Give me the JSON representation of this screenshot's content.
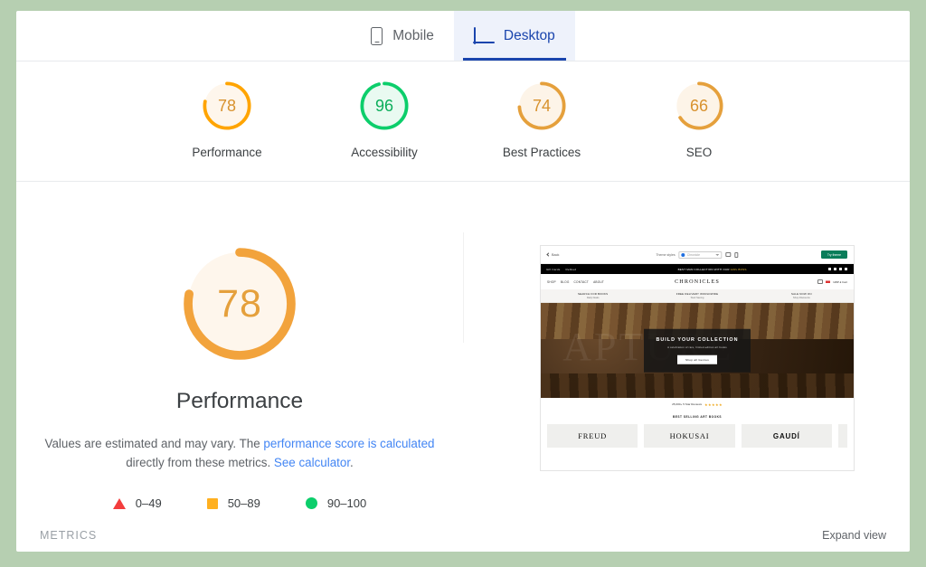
{
  "tabs": [
    {
      "label": "Mobile",
      "icon": "mobile-icon",
      "active": false
    },
    {
      "label": "Desktop",
      "icon": "desktop-icon",
      "active": true
    }
  ],
  "scores": [
    {
      "label": "Performance",
      "value": 78,
      "color": "#ffa400",
      "track": "#fef6ec"
    },
    {
      "label": "Accessibility",
      "value": 96,
      "color": "#0cce6b",
      "track": "#e9faf1"
    },
    {
      "label": "Best Practices",
      "value": 74,
      "color": "#e5a03c",
      "track": "#fdf4e8"
    },
    {
      "label": "SEO",
      "value": 66,
      "color": "#e5a03c",
      "track": "#fdf4e8"
    }
  ],
  "detail": {
    "gauge_value": 78,
    "title": "Performance",
    "desc_part1": "Values are estimated and may vary. The ",
    "desc_link1": "performance score is calculated",
    "desc_part2": " directly from these metrics. ",
    "desc_link2": "See calculator",
    "desc_part3": "."
  },
  "legend": [
    {
      "shape": "triangle",
      "label": "0–49",
      "color": "#f33d3d"
    },
    {
      "shape": "square",
      "label": "50–89",
      "color": "#ffb020"
    },
    {
      "shape": "circle",
      "label": "90–100",
      "color": "#0cce6b"
    }
  ],
  "footer": {
    "metrics_label": "METRICS",
    "expand_label": "Expand view"
  },
  "thumbnail": {
    "topbar": {
      "back_label": "Back",
      "theme_label": "Theme styles",
      "select_value": "Chronicle",
      "cta_label": "Try theme"
    },
    "announcement": {
      "left_a": "Gift Cards",
      "left_b": "Refined",
      "center_pre": "BEST MAN COLLECTION WITH OUR ",
      "center_em": "GIRL BOSS"
    },
    "nav": [
      "SHOP",
      "BLOG",
      "CONTACT",
      "ABOUT"
    ],
    "brand": "CHRONICLES",
    "header_right": "GBP £   Cart",
    "promos": [
      {
        "line1": "SEARCH FOR BOOKS",
        "line2": "Daily Deals"
      },
      {
        "line1": "FREE DELIVERY WORLDWIDE",
        "line2": "Start Saving"
      },
      {
        "line1": "SALE NOW ON",
        "line2": "Shop Discounts"
      }
    ],
    "hero": {
      "ghost_text": "APTURE",
      "heading": "BUILD YOUR COLLECTION",
      "sub": "A celebration of rare, limited-edition art books",
      "button": "Shop all Genres"
    },
    "reviews": {
      "text": "25,000+ 5 Star Reviews",
      "stars": "★★★★★"
    },
    "bestselling_title": "BEST SELLING ART BOOKS",
    "books": [
      "FREUD",
      "HOKUSAI",
      "GAUDÍ"
    ]
  }
}
